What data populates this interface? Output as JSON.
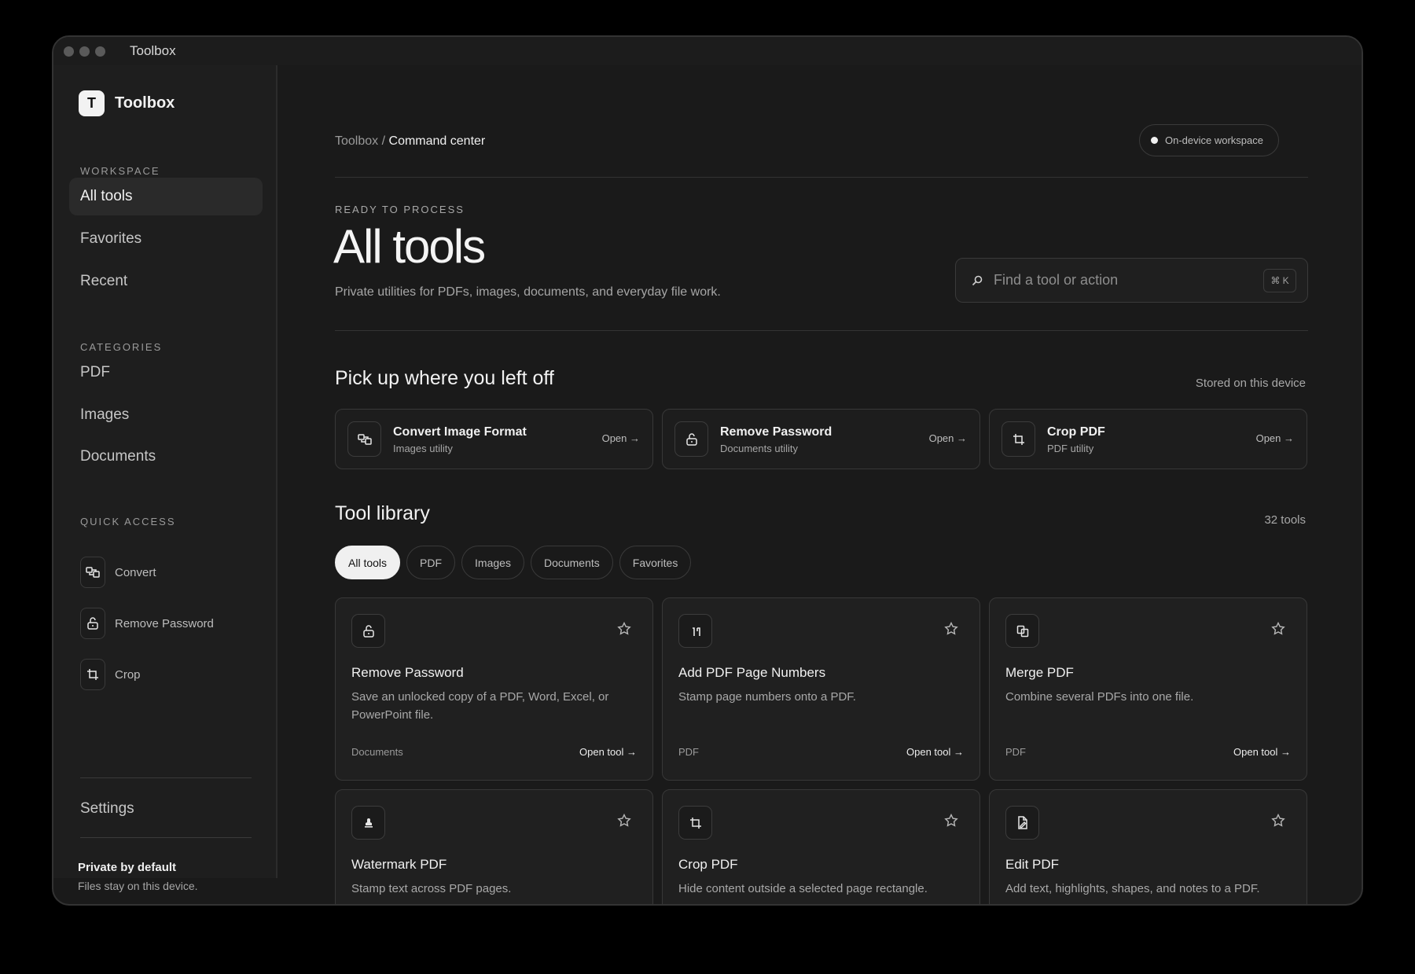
{
  "window": {
    "title": "Toolbox"
  },
  "sidebar": {
    "brand": {
      "mark": "T",
      "name": "Toolbox"
    },
    "workspace_label": "WORKSPACE",
    "workspace": [
      {
        "label": "All tools",
        "active": true
      },
      {
        "label": "Favorites",
        "active": false
      },
      {
        "label": "Recent",
        "active": false
      }
    ],
    "categories_label": "CATEGORIES",
    "categories": [
      "PDF",
      "Images",
      "Documents"
    ],
    "quick_access_label": "QUICK ACCESS",
    "quick_access": [
      {
        "label": "Convert",
        "icon": "convert-icon"
      },
      {
        "label": "Remove Password",
        "icon": "unlock-icon"
      },
      {
        "label": "Crop",
        "icon": "crop-icon"
      }
    ],
    "settings": "Settings",
    "privacy": {
      "title": "Private by default",
      "subtitle": "Files stay on this device."
    }
  },
  "header": {
    "breadcrumb": {
      "root": "Toolbox",
      "separator": "/",
      "current": "Command center"
    },
    "status": "On-device workspace"
  },
  "hero": {
    "eyebrow": "READY TO PROCESS",
    "title": "All tools",
    "subtitle": "Private utilities for PDFs, images, documents, and everyday file work.",
    "search": {
      "placeholder": "Find a tool or action",
      "shortcut": "⌘ K"
    }
  },
  "recent": {
    "title": "Pick up where you left off",
    "meta": "Stored on this device",
    "items": [
      {
        "title": "Convert Image Format",
        "subtitle": "Images utility",
        "action": "Open →",
        "icon": "convert-icon"
      },
      {
        "title": "Remove Password",
        "subtitle": "Documents utility",
        "action": "Open →",
        "icon": "unlock-icon"
      },
      {
        "title": "Crop PDF",
        "subtitle": "PDF utility",
        "action": "Open →",
        "icon": "crop-icon"
      }
    ]
  },
  "library": {
    "title": "Tool library",
    "count": "32 tools",
    "filters": [
      {
        "label": "All tools",
        "active": true
      },
      {
        "label": "PDF",
        "active": false
      },
      {
        "label": "Images",
        "active": false
      },
      {
        "label": "Documents",
        "active": false
      },
      {
        "label": "Favorites",
        "active": false
      }
    ],
    "tools": [
      {
        "title": "Remove Password",
        "description": "Save an unlocked copy of a PDF, Word, Excel, or PowerPoint file.",
        "category": "Documents",
        "action": "Open tool →",
        "icon": "unlock-icon"
      },
      {
        "title": "Add PDF Page Numbers",
        "description": "Stamp page numbers onto a PDF.",
        "category": "PDF",
        "action": "Open tool →",
        "icon": "page-numbers-icon"
      },
      {
        "title": "Merge PDF",
        "description": "Combine several PDFs into one file.",
        "category": "PDF",
        "action": "Open tool →",
        "icon": "merge-icon"
      },
      {
        "title": "Watermark PDF",
        "description": "Stamp text across PDF pages.",
        "category": "",
        "action": "",
        "icon": "stamp-icon"
      },
      {
        "title": "Crop PDF",
        "description": "Hide content outside a selected page rectangle.",
        "category": "",
        "action": "",
        "icon": "crop-icon"
      },
      {
        "title": "Edit PDF",
        "description": "Add text, highlights, shapes, and notes to a PDF.",
        "category": "",
        "action": "",
        "icon": "edit-icon"
      }
    ]
  }
}
